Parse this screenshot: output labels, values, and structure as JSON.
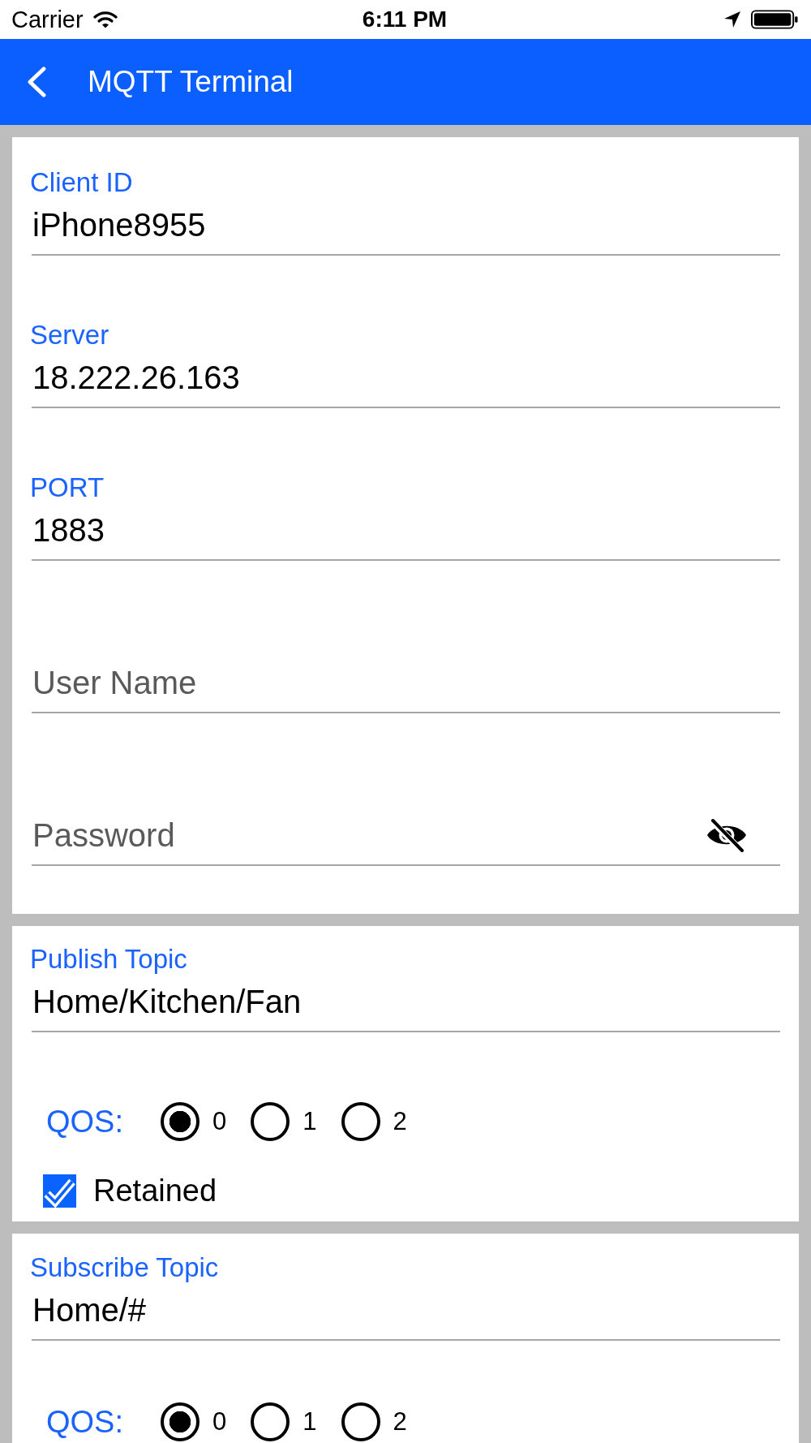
{
  "status_bar": {
    "carrier": "Carrier",
    "time": "6:11 PM"
  },
  "nav_bar": {
    "title": "MQTT Terminal"
  },
  "connection": {
    "fields": [
      {
        "kind": "text",
        "label": "Client ID",
        "value": "iPhone8955"
      },
      {
        "kind": "text",
        "label": "Server",
        "value": "18.222.26.163"
      },
      {
        "kind": "text",
        "label": "PORT",
        "value": "1883"
      },
      {
        "kind": "text",
        "placeholder": "User Name"
      },
      {
        "kind": "password",
        "placeholder": "Password"
      }
    ]
  },
  "publish": {
    "topic": {
      "label": "Publish Topic",
      "value": "Home/Kitchen/Fan"
    },
    "qos": {
      "label": "QOS:",
      "options": [
        {
          "label": "0",
          "selected": true
        },
        {
          "label": "1",
          "selected": false
        },
        {
          "label": "2",
          "selected": false
        }
      ]
    },
    "retained": {
      "label": "Retained",
      "checked": true
    }
  },
  "subscribe": {
    "topic": {
      "label": "Subscribe Topic",
      "value": "Home/#"
    },
    "qos": {
      "label": "QOS:",
      "options": [
        {
          "label": "0",
          "selected": true
        },
        {
          "label": "1",
          "selected": false
        },
        {
          "label": "2",
          "selected": false
        }
      ]
    }
  }
}
